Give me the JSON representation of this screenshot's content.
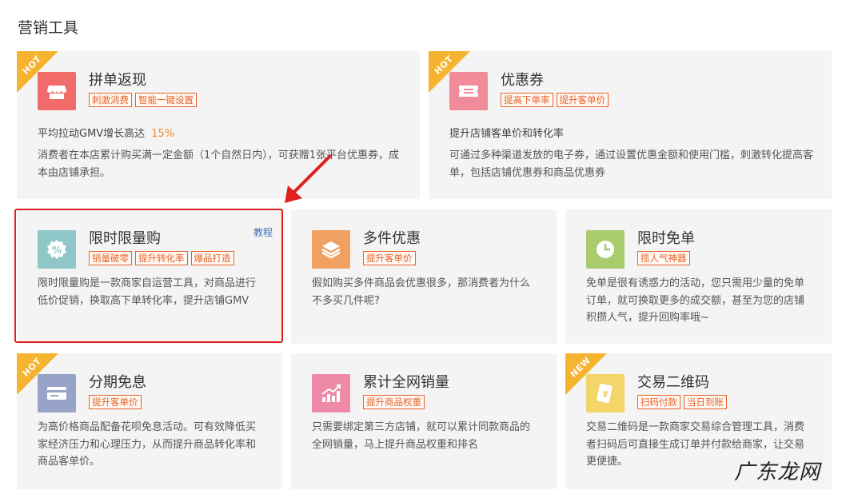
{
  "page_title": "营销工具",
  "ribbon_hot": "HOT",
  "ribbon_new": "NEW",
  "tutorial_link": "教程",
  "watermark": "广东龙网",
  "colors": {
    "tag": "#e8632a",
    "ribbon": "#f6b32f",
    "highlight": "#e02020"
  },
  "cards": [
    {
      "name": "拼单返现",
      "tags": [
        "刺激消费",
        "智能一键设置"
      ],
      "stat_label": "平均拉动GMV增长高达",
      "stat_value": "15%",
      "desc": "消费者在本店累计购买满一定金额（1个自然日内），可获赠1张平台优惠券，成本由店铺承担。",
      "icon": "store-icon"
    },
    {
      "name": "优惠券",
      "tags": [
        "提高下单率",
        "提升客单价"
      ],
      "stat_label": "提升店铺客单价和转化率",
      "desc": "可通过多种渠道发放的电子券，通过设置优惠金额和使用门槛，刺激转化提高客单，包括店铺优惠券和商品优惠券",
      "icon": "ticket-icon"
    },
    {
      "name": "限时限量购",
      "tags": [
        "销量破零",
        "提升转化率",
        "爆品打造"
      ],
      "desc": "限时限量购是一款商家自运营工具，对商品进行低价促销，换取高下单转化率，提升店铺GMV",
      "icon": "percent-icon"
    },
    {
      "name": "多件优惠",
      "tags": [
        "提升客单价"
      ],
      "desc": "假如购买多件商品会优惠很多，那消费者为什么不多买几件呢?",
      "icon": "layers-icon"
    },
    {
      "name": "限时免单",
      "tags": [
        "揽人气神器"
      ],
      "desc": "免单是很有诱惑力的活动，您只需用少量的免单订单，就可换取更多的成交额，甚至为您的店铺积攒人气，提升回购率哦~",
      "icon": "clock-icon"
    },
    {
      "name": "分期免息",
      "tags": [
        "提升客单价"
      ],
      "desc": "为高价格商品配备花呗免息活动。可有效降低买家经济压力和心理压力，从而提升商品转化率和商品客单价。",
      "icon": "credit-card-icon"
    },
    {
      "name": "累计全网销量",
      "tags": [
        "提升商品权重"
      ],
      "desc": "只需要绑定第三方店铺，就可以累计同款商品的全网销量，马上提升商品权重和排名",
      "icon": "growth-chart-icon"
    },
    {
      "name": "交易二维码",
      "tags": [
        "扫码付款",
        "当日到账"
      ],
      "desc": "交易二维码是一款商家交易综合管理工具，消费者扫码后可直接生成订单并付款给商家，让交易更便捷。",
      "icon": "qr-payment-icon"
    }
  ]
}
